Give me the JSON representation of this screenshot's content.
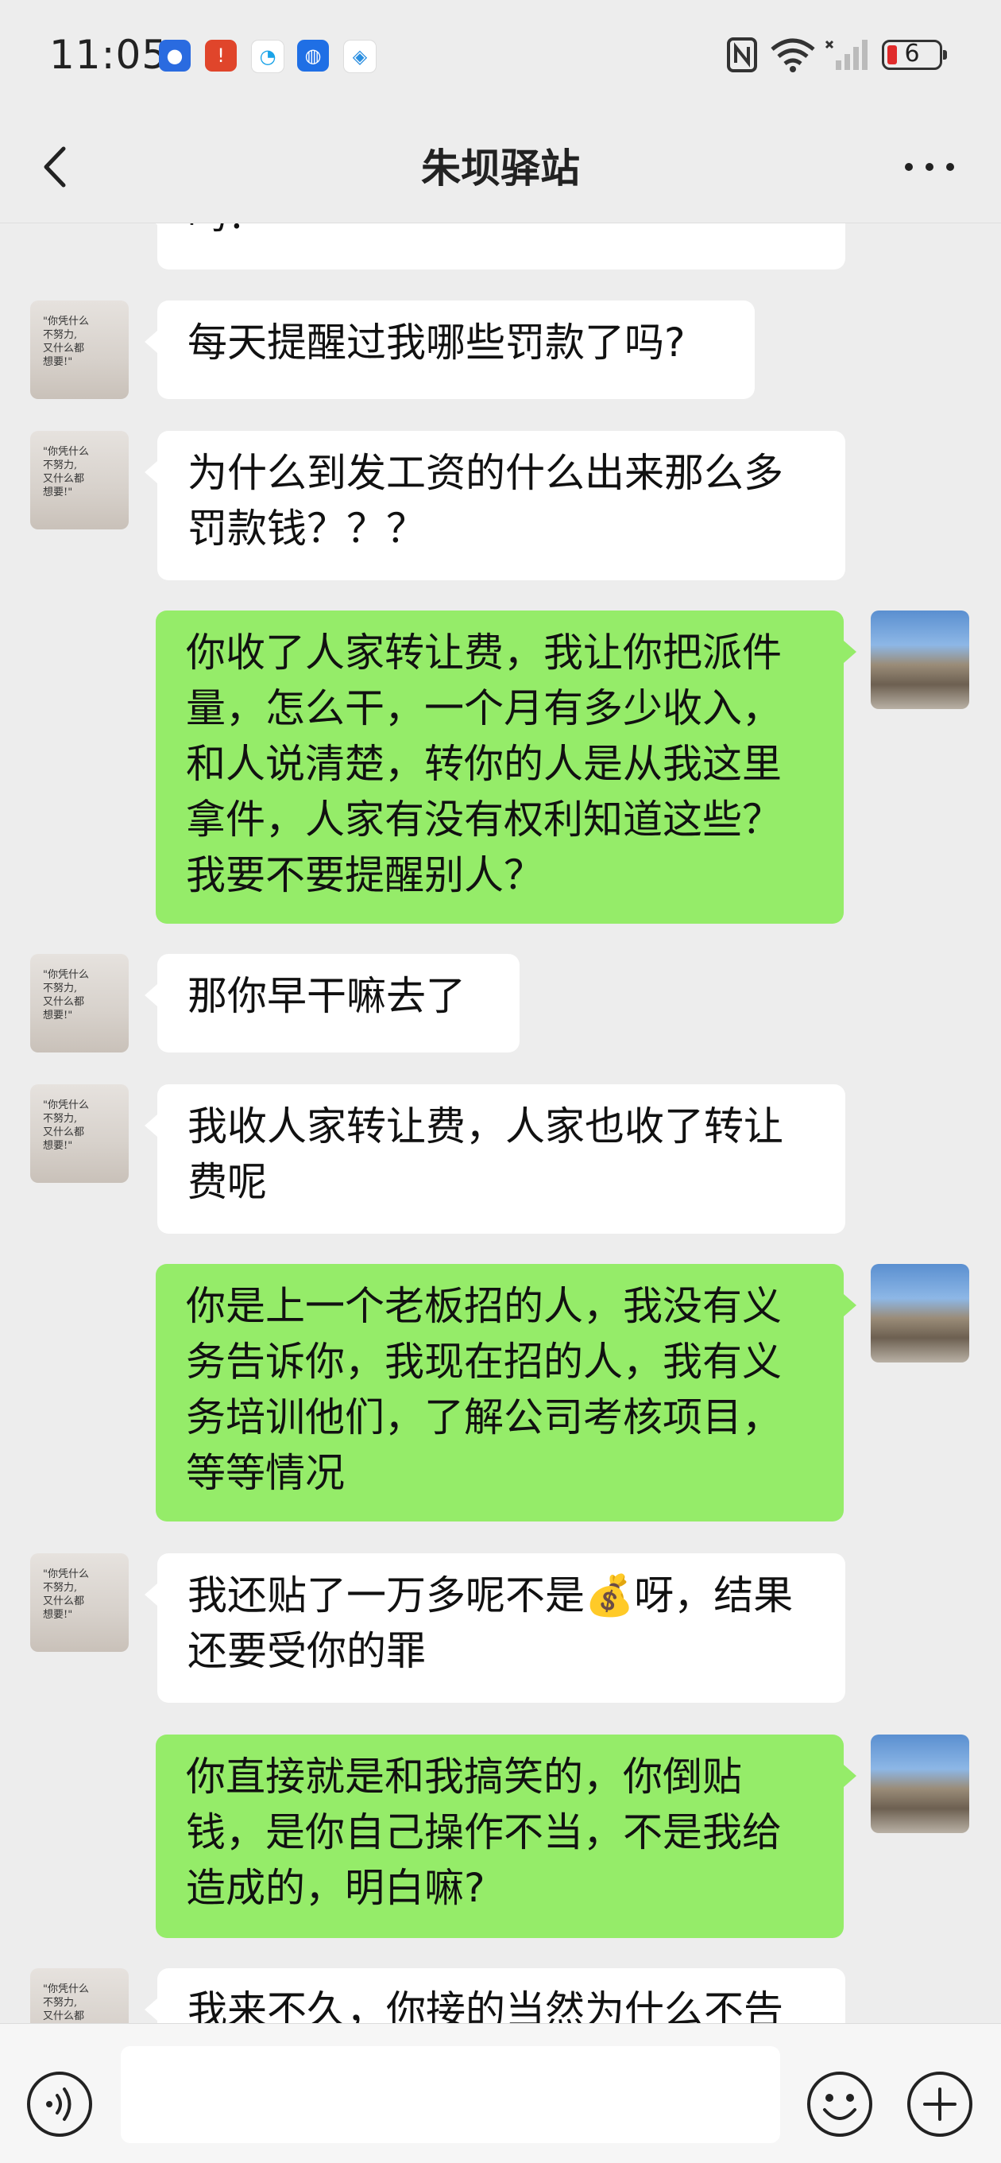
{
  "status_bar": {
    "time": "11:05",
    "battery_level": "6",
    "notif_icons": [
      "baidu-icon",
      "battery-alert-icon",
      "chat-icon",
      "lightbulb-icon",
      "browser-icon"
    ],
    "system_icons": [
      "nfc-icon",
      "wifi-icon",
      "signal-icon"
    ]
  },
  "header": {
    "title": "朱坝驿站",
    "back_icon": "chevron-left-icon",
    "more_icon": "more-icon"
  },
  "messages": [
    {
      "from": "other",
      "text": "吗？"
    },
    {
      "from": "other",
      "text": "每天提醒过我哪些罚款了吗?"
    },
    {
      "from": "other",
      "text": "为什么到发工资的什么出来那么多罚款钱？？？"
    },
    {
      "from": "me",
      "text": "你收了人家转让费，我让你把派件量，怎么干，一个月有多少收入，和人说清楚，转你的人是从我这里拿件，人家有没有权利知道这些？我要不要提醒别人？"
    },
    {
      "from": "other",
      "text": "那你早干嘛去了"
    },
    {
      "from": "other",
      "text": "我收人家转让费，人家也收了转让费呢"
    },
    {
      "from": "me",
      "text": "你是上一个老板招的人，我没有义务告诉你，我现在招的人，我有义务培训他们，了解公司考核项目，等等情况"
    },
    {
      "from": "other",
      "text": "我还贴了一万多呢不是💰呀，结果还要受你的罪"
    },
    {
      "from": "me",
      "text": "你直接就是和我搞笑的，你倒贴钱，是你自己操作不当，不是我给造成的，明白嘛?"
    },
    {
      "from": "other",
      "text": "我来不久，你接的当然为什么不告"
    }
  ],
  "input_bar": {
    "voice_icon": "voice-icon",
    "emoji_icon": "emoji-icon",
    "add_icon": "plus-icon",
    "input_value": ""
  },
  "colors": {
    "background": "#ededed",
    "incoming_bubble": "#ffffff",
    "outgoing_bubble": "#95ec69"
  }
}
